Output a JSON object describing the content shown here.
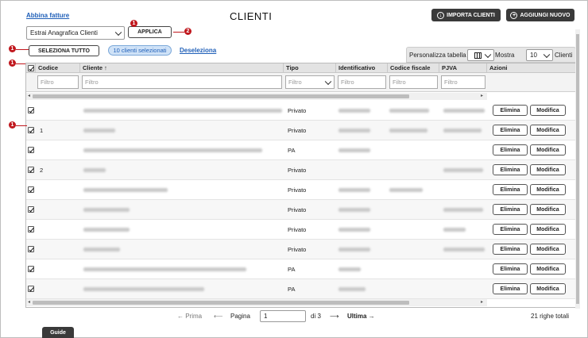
{
  "header": {
    "link_label": "Abbina fatture",
    "title": "CLIENTI",
    "import_label": "IMPORTA CLIENTI",
    "add_label": "AGGIUNGI NUOVO"
  },
  "toolbar": {
    "extract_select_value": "Estrai Anagrafica Clienti",
    "apply_label": "APPLICA",
    "select_all_label": "SELEZIONA TUTTO",
    "selected_count_label": "10 clienti selezionati",
    "deselect_label": "Deseleziona",
    "customize_label": "Personalizza tabella",
    "show_label": "Mostra",
    "show_value": "10",
    "clients_label": "Clienti"
  },
  "callouts": {
    "badge_1": "1",
    "badge_2": "2"
  },
  "table": {
    "columns": [
      "Codice",
      "Cliente ↑",
      "Tipo",
      "Identificativo",
      "Codice fiscale",
      "PJVA",
      "Azioni"
    ],
    "filter_placeholder": "Filtro",
    "delete_label": "Elimina",
    "edit_label": "Modifica",
    "rows": [
      {
        "code": "",
        "type": "Privato"
      },
      {
        "code": "1",
        "type": "Privato"
      },
      {
        "code": "",
        "type": "PA"
      },
      {
        "code": "2",
        "type": "Privato"
      },
      {
        "code": "",
        "type": "Privato"
      },
      {
        "code": "",
        "type": "Privato"
      },
      {
        "code": "",
        "type": "Privato"
      },
      {
        "code": "",
        "type": "Privato"
      },
      {
        "code": "",
        "type": "PA"
      },
      {
        "code": "",
        "type": "PA"
      }
    ]
  },
  "pager": {
    "first_label": "Prima",
    "page_label": "Pagina",
    "page_value": "1",
    "of_label": "di 3",
    "last_label": "Ultima",
    "total_label": "21 righe totali"
  },
  "footer": {
    "guide_label": "Guide"
  },
  "colors": {
    "accent_link": "#1f5fb8",
    "dark_button": "#3a3a3a",
    "callout_red": "#c0171d",
    "pill_bg": "#cfe2f7"
  }
}
